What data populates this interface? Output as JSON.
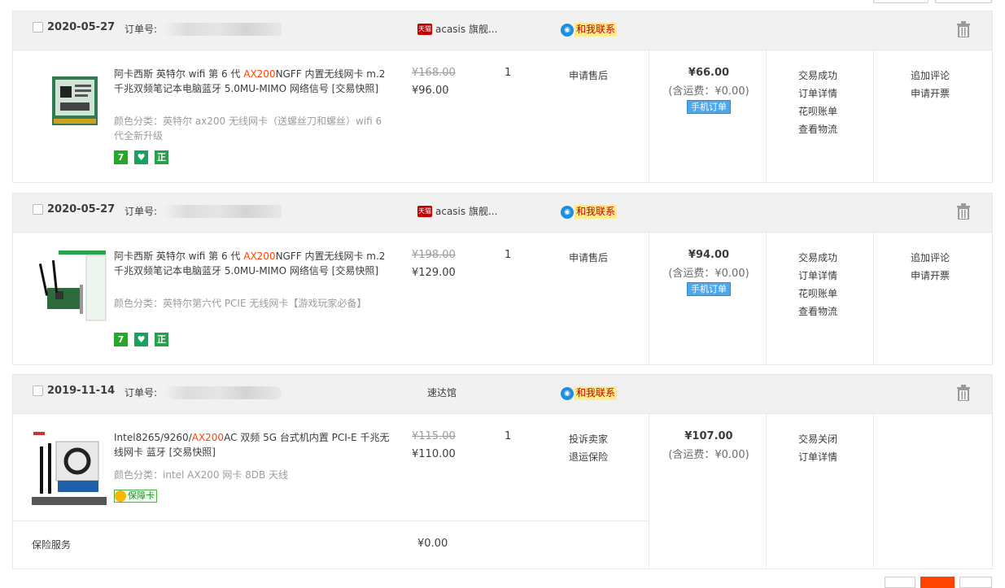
{
  "orders": [
    {
      "date": "2020-05-27",
      "order_no_label": "订单号:",
      "shop": "acasis 旗舰...",
      "shop_icon": "tmall-icon",
      "contact": "和我联系",
      "title_pre": "阿卡西斯 英特尔 wifi 第 6 代 ",
      "title_hl": "AX200",
      "title_post": "NGFF 内置无线网卡 m.2 千兆双频笔记本电脑蓝牙 5.0MU-MIMO 网络信号 [交易快照]",
      "sku": "颜色分类：英特尔 ax200 无线网卡（送螺丝刀和螺丝）wifi 6 代全新升级",
      "service_icons": [
        "7",
        "♥",
        "正"
      ],
      "price_original": "¥168.00",
      "price_actual": "¥96.00",
      "qty": "1",
      "after_sale": [
        "申请售后"
      ],
      "total": "¥66.00",
      "shipping": "(含运费：¥0.00)",
      "badge": "手机订单",
      "status": [
        "交易成功",
        "订单详情",
        "花呗账单",
        "查看物流"
      ],
      "actions": [
        "追加评论",
        "申请开票"
      ]
    },
    {
      "date": "2020-05-27",
      "order_no_label": "订单号:",
      "shop": "acasis 旗舰...",
      "shop_icon": "tmall-icon",
      "contact": "和我联系",
      "title_pre": "阿卡西斯 英特尔 wifi 第 6 代 ",
      "title_hl": "AX200",
      "title_post": "NGFF 内置无线网卡 m.2 千兆双频笔记本电脑蓝牙 5.0MU-MIMO 网络信号 [交易快照]",
      "sku": "颜色分类：英特尔第六代 PCIE 无线网卡【游戏玩家必备】",
      "service_icons": [
        "7",
        "♥",
        "正"
      ],
      "price_original": "¥198.00",
      "price_actual": "¥129.00",
      "qty": "1",
      "after_sale": [
        "申请售后"
      ],
      "total": "¥94.00",
      "shipping": "(含运费：¥0.00)",
      "badge": "手机订单",
      "status": [
        "交易成功",
        "订单详情",
        "花呗账单",
        "查看物流"
      ],
      "actions": [
        "追加评论",
        "申请开票"
      ]
    },
    {
      "date": "2019-11-14",
      "order_no_label": "订单号:",
      "shop": "速达馆",
      "contact": "和我联系",
      "title_pre": "Intel8265/9260/",
      "title_hl": "AX200",
      "title_post": "AC 双频 5G 台式机内置 PCI-E 千兆无线网卡 蓝牙 [交易快照]",
      "sku": "颜色分类：intel AX200 网卡 8DB 天线",
      "guard": "保障卡",
      "price_original": "¥115.00",
      "price_actual": "¥110.00",
      "qty": "1",
      "after_sale": [
        "投诉卖家",
        "退运保险"
      ],
      "total": "¥107.00",
      "shipping": "(含运费：¥0.00)",
      "status": [
        "交易关闭",
        "订单详情"
      ],
      "insurance_label": "保险服务",
      "insurance_price": "¥0.00"
    }
  ]
}
